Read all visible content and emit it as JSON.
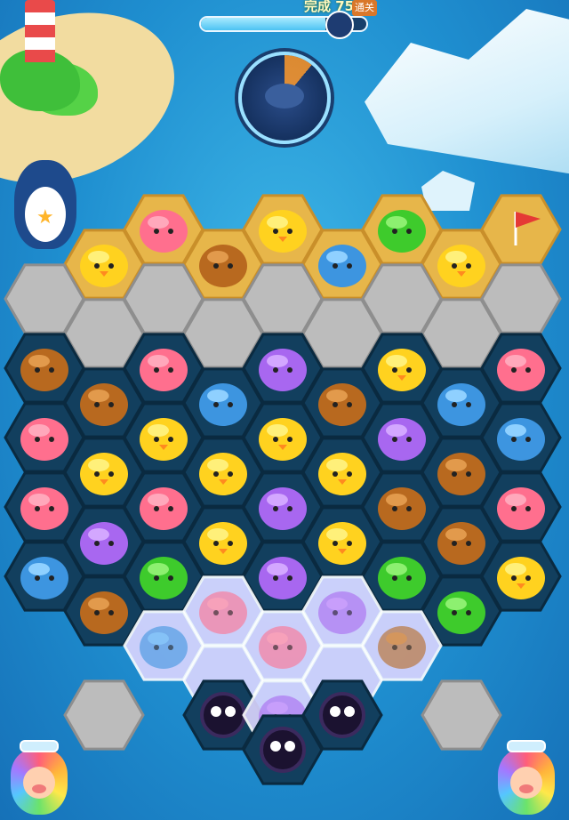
{
  "hud": {
    "progress_label": "完成 75%",
    "progress_flag": "通关",
    "progress_fraction": 0.75,
    "radar_fill_fraction": 0.11
  },
  "decor": {
    "mascot": "penguin",
    "mascot_badge": "star-icon",
    "goal": "red-flag"
  },
  "board": {
    "tiles": [
      {
        "r": 0,
        "c": 2,
        "k": "honey",
        "p": "pink"
      },
      {
        "r": 0,
        "c": 4,
        "k": "honey",
        "p": "chick"
      },
      {
        "r": 0,
        "c": 6,
        "k": "honey",
        "p": "frog"
      },
      {
        "r": 0,
        "c": 8,
        "k": "honey",
        "p": "flag"
      },
      {
        "r": 1,
        "c": 1,
        "k": "honey",
        "p": "chick"
      },
      {
        "r": 1,
        "c": 3,
        "k": "honey",
        "p": "bear"
      },
      {
        "r": 1,
        "c": 5,
        "k": "honey",
        "p": "shell"
      },
      {
        "r": 1,
        "c": 7,
        "k": "honey",
        "p": "chick"
      },
      {
        "r": 2,
        "c": 0,
        "k": "stone"
      },
      {
        "r": 2,
        "c": 2,
        "k": "stone"
      },
      {
        "r": 2,
        "c": 4,
        "k": "stone"
      },
      {
        "r": 2,
        "c": 6,
        "k": "stone"
      },
      {
        "r": 2,
        "c": 8,
        "k": "stone"
      },
      {
        "r": 3,
        "c": 1,
        "k": "stone"
      },
      {
        "r": 3,
        "c": 3,
        "k": "stone"
      },
      {
        "r": 3,
        "c": 5,
        "k": "stone"
      },
      {
        "r": 3,
        "c": 7,
        "k": "stone"
      },
      {
        "r": 4,
        "c": 0,
        "k": "dark",
        "p": "bear"
      },
      {
        "r": 4,
        "c": 2,
        "k": "dark",
        "p": "pink"
      },
      {
        "r": 4,
        "c": 4,
        "k": "dark",
        "p": "cat"
      },
      {
        "r": 4,
        "c": 6,
        "k": "dark",
        "p": "chick"
      },
      {
        "r": 4,
        "c": 8,
        "k": "dark",
        "p": "pink"
      },
      {
        "r": 5,
        "c": 1,
        "k": "dark",
        "p": "bear"
      },
      {
        "r": 5,
        "c": 3,
        "k": "dark",
        "p": "shell"
      },
      {
        "r": 5,
        "c": 5,
        "k": "dark",
        "p": "bear"
      },
      {
        "r": 5,
        "c": 7,
        "k": "dark",
        "p": "shell"
      },
      {
        "r": 6,
        "c": 0,
        "k": "dark",
        "p": "pink"
      },
      {
        "r": 6,
        "c": 2,
        "k": "dark",
        "p": "chick"
      },
      {
        "r": 6,
        "c": 4,
        "k": "dark",
        "p": "chick"
      },
      {
        "r": 6,
        "c": 6,
        "k": "dark",
        "p": "cat"
      },
      {
        "r": 6,
        "c": 8,
        "k": "dark",
        "p": "shell"
      },
      {
        "r": 7,
        "c": 1,
        "k": "dark",
        "p": "chick"
      },
      {
        "r": 7,
        "c": 3,
        "k": "dark",
        "p": "chick"
      },
      {
        "r": 7,
        "c": 5,
        "k": "dark",
        "p": "chick"
      },
      {
        "r": 7,
        "c": 7,
        "k": "dark",
        "p": "bear"
      },
      {
        "r": 8,
        "c": 0,
        "k": "dark",
        "p": "pink"
      },
      {
        "r": 8,
        "c": 2,
        "k": "dark",
        "p": "pink"
      },
      {
        "r": 8,
        "c": 4,
        "k": "dark",
        "p": "cat"
      },
      {
        "r": 8,
        "c": 6,
        "k": "dark",
        "p": "bear"
      },
      {
        "r": 8,
        "c": 8,
        "k": "dark",
        "p": "pink"
      },
      {
        "r": 9,
        "c": 1,
        "k": "dark",
        "p": "cat"
      },
      {
        "r": 9,
        "c": 3,
        "k": "dark",
        "p": "chick"
      },
      {
        "r": 9,
        "c": 5,
        "k": "dark",
        "p": "chick"
      },
      {
        "r": 9,
        "c": 7,
        "k": "dark",
        "p": "bear"
      },
      {
        "r": 10,
        "c": 0,
        "k": "dark",
        "p": "shell"
      },
      {
        "r": 10,
        "c": 2,
        "k": "dark",
        "p": "frog"
      },
      {
        "r": 10,
        "c": 4,
        "k": "dark",
        "p": "cat"
      },
      {
        "r": 10,
        "c": 6,
        "k": "dark",
        "p": "frog"
      },
      {
        "r": 10,
        "c": 8,
        "k": "dark",
        "p": "chick"
      },
      {
        "r": 11,
        "c": 1,
        "k": "dark",
        "p": "bear"
      },
      {
        "r": 11,
        "c": 3,
        "k": "ice",
        "p": "pink"
      },
      {
        "r": 11,
        "c": 5,
        "k": "ice",
        "p": "cat"
      },
      {
        "r": 11,
        "c": 7,
        "k": "dark",
        "p": "frog"
      },
      {
        "r": 12,
        "c": 2,
        "k": "ice",
        "p": "shell"
      },
      {
        "r": 12,
        "c": 4,
        "k": "ice",
        "p": "pink"
      },
      {
        "r": 12,
        "c": 6,
        "k": "ice",
        "p": "bear"
      },
      {
        "r": 13,
        "c": 3,
        "k": "ice"
      },
      {
        "r": 13,
        "c": 5,
        "k": "ice"
      },
      {
        "r": 14,
        "c": 1,
        "k": "stone"
      },
      {
        "r": 14,
        "c": 3,
        "k": "dark",
        "p": "spider"
      },
      {
        "r": 14,
        "c": 4,
        "k": "ice",
        "p": "cat"
      },
      {
        "r": 14,
        "c": 5,
        "k": "dark",
        "p": "spider"
      },
      {
        "r": 14,
        "c": 7,
        "k": "stone"
      },
      {
        "r": 15,
        "c": 4,
        "k": "dark",
        "p": "spider"
      }
    ]
  },
  "pieces": {
    "pink": {
      "color": "#ff6f8e",
      "light": "#ffa8bb"
    },
    "chick": {
      "color": "#ffd21f",
      "light": "#fff07a"
    },
    "bear": {
      "color": "#b8691f",
      "light": "#e29a4c"
    },
    "frog": {
      "color": "#3ecb2c",
      "light": "#8df070"
    },
    "shell": {
      "color": "#3d95e0",
      "light": "#8fd0ff"
    },
    "cat": {
      "color": "#a867f0",
      "light": "#d3a7ff"
    },
    "spider": {
      "color": "#1b1230",
      "light": "#3b2a5e"
    },
    "flag": {
      "color": "#e53935",
      "light": "#ff8a80"
    }
  },
  "tile_colors": {
    "honey": "#e7b64a",
    "stone": "#bcbcbc",
    "dark": "#123f5e",
    "ice": "#dcd6ff"
  },
  "jars": [
    {
      "name": "left-rainbow-jar"
    },
    {
      "name": "right-rainbow-jar"
    }
  ]
}
